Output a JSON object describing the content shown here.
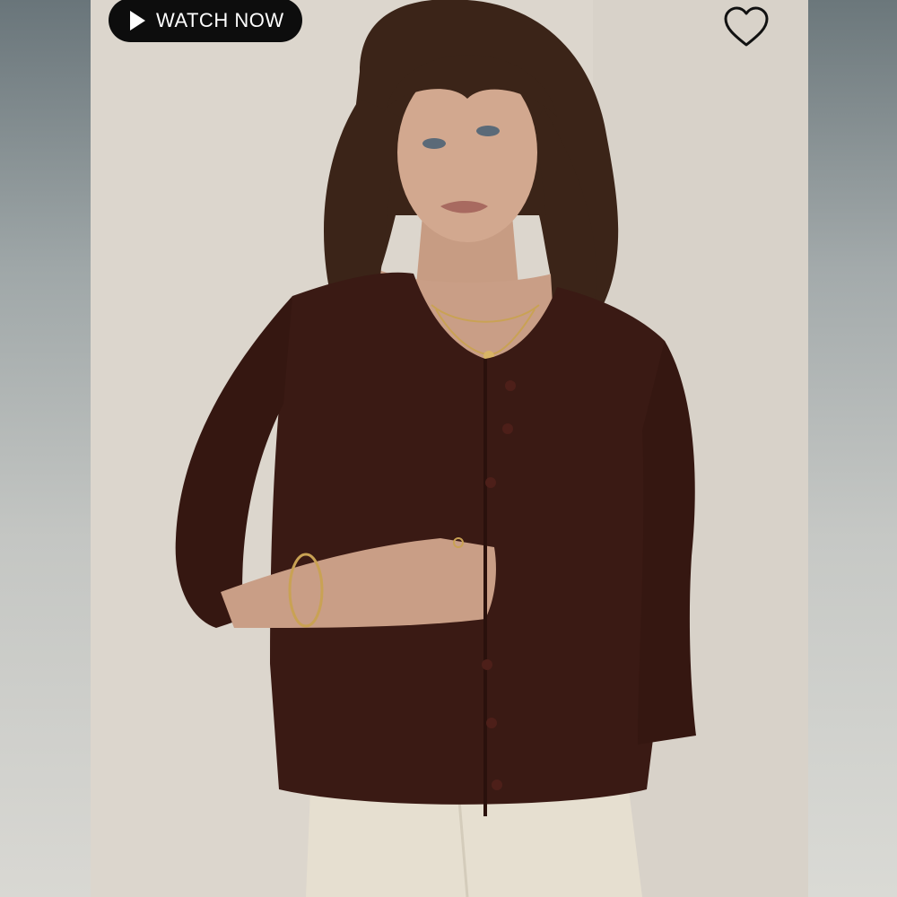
{
  "watch_button": {
    "label": "WATCH NOW",
    "icon": "play-icon"
  },
  "favorite": {
    "icon": "heart-outline-icon"
  },
  "colors": {
    "button_background": "#0d0d0d",
    "button_text": "#ffffff",
    "photo_background": "#d9d3ca",
    "cardigan": "#3a1a14",
    "pants": "#e6dfd0",
    "hair": "#3b2418"
  }
}
